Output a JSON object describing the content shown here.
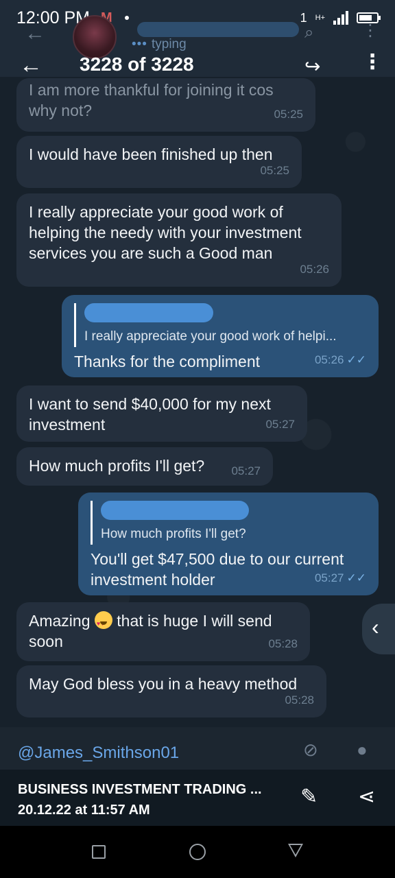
{
  "status_bar": {
    "time": "12:00 PM",
    "gmail_icon": "M",
    "network": "H+",
    "sim": "1"
  },
  "chat_header": {
    "status": "typing"
  },
  "viewer": {
    "counter": "3228 of 3228"
  },
  "messages": [
    {
      "text": "I am more thankful for joining it cos why not?",
      "time": "05:25"
    },
    {
      "text": "I would have been finished up then",
      "time": "05:25"
    },
    {
      "text": "I really appreciate your good work of helping the needy with your investment services you are such a Good man",
      "time": "05:26"
    },
    {
      "reply_to": "I really appreciate your good work of helpi...",
      "text": "Thanks for the compliment",
      "time": "05:26",
      "ticks": "✓✓"
    },
    {
      "text": "I want to send $40,000 for my next investment",
      "time": "05:27"
    },
    {
      "text": "How much profits I'll get?",
      "time": "05:27"
    },
    {
      "reply_to": "How much profits I'll get?",
      "text": "You'll get $47,500 due to our current investment holder",
      "time": "05:27",
      "ticks": "✓✓"
    },
    {
      "text_before": "Amazing",
      "text_after": "that is huge I will send soon",
      "time": "05:28"
    },
    {
      "text": "May God bless you in a heavy method",
      "time": "05:28"
    }
  ],
  "input_bar": {
    "mention": "@James_Smithson01"
  },
  "caption": {
    "title": "BUSINESS INVESTMENT TRADING ...",
    "date": "20.12.22 at 11:57 AM"
  },
  "icons": {
    "back": "arrow-left-icon",
    "forward": "forward-icon",
    "menu": "more-vert-icon",
    "edit": "brush-icon",
    "share": "share-icon",
    "attach": "paperclip-icon",
    "mic": "mic-icon"
  }
}
